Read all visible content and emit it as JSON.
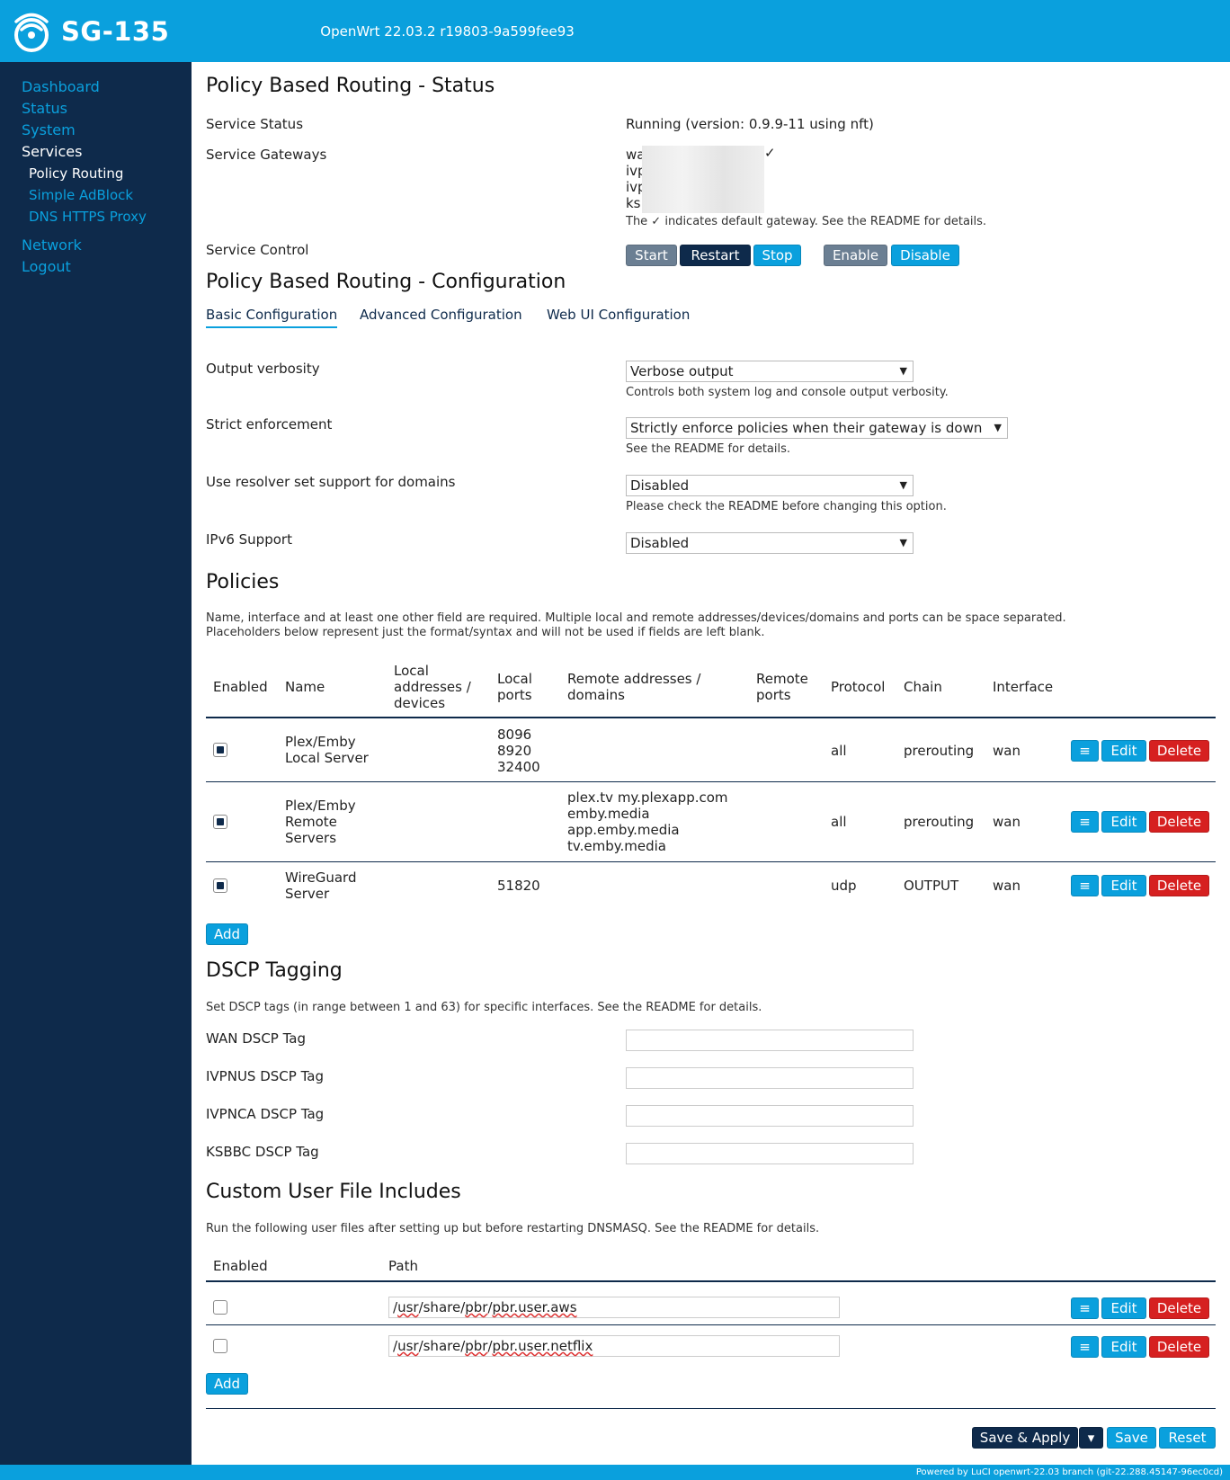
{
  "header": {
    "hostname": "SG-135",
    "firmware": "OpenWrt 22.03.2 r19803-9a599fee93"
  },
  "sidebar": {
    "items": [
      {
        "label": "Dashboard"
      },
      {
        "label": "Status"
      },
      {
        "label": "System"
      },
      {
        "label": "Services"
      },
      {
        "label": "Policy Routing"
      },
      {
        "label": "Simple AdBlock"
      },
      {
        "label": "DNS HTTPS Proxy"
      },
      {
        "label": "Network"
      },
      {
        "label": "Logout"
      }
    ]
  },
  "status": {
    "title": "Policy Based Routing - Status",
    "service_status_label": "Service Status",
    "service_status_value": "Running (version: 0.9.9-11 using nft)",
    "gateways_label": "Service Gateways",
    "gateways": [
      "wa",
      "ivp",
      "ivp",
      "ks"
    ],
    "gateway_check": "✓",
    "gateway_note": "The ✓ indicates default gateway. See the README for details.",
    "control_label": "Service Control",
    "buttons": {
      "start": "Start",
      "restart": "Restart",
      "stop": "Stop",
      "enable": "Enable",
      "disable": "Disable"
    }
  },
  "config": {
    "title": "Policy Based Routing - Configuration",
    "tabs": [
      "Basic Configuration",
      "Advanced Configuration",
      "Web UI Configuration"
    ],
    "output_verbosity": {
      "label": "Output verbosity",
      "value": "Verbose output",
      "hint": "Controls both system log and console output verbosity."
    },
    "strict_enforcement": {
      "label": "Strict enforcement",
      "value": "Strictly enforce policies when their gateway is down",
      "hint": "See the README for details."
    },
    "resolver_set": {
      "label": "Use resolver set support for domains",
      "value": "Disabled",
      "hint": "Please check the README before changing this option."
    },
    "ipv6": {
      "label": "IPv6 Support",
      "value": "Disabled"
    }
  },
  "policies": {
    "title": "Policies",
    "description_1": "Name, interface and at least one other field are required. Multiple local and remote addresses/devices/domains and ports can be space separated.",
    "description_2": "Placeholders below represent just the format/syntax and will not be used if fields are left blank.",
    "columns": {
      "enabled": "Enabled",
      "name": "Name",
      "local_addr_1": "Local",
      "local_addr_2": "addresses /",
      "local_addr_3": "devices",
      "local_ports_1": "Local",
      "local_ports_2": "ports",
      "remote_addr_1": "Remote addresses /",
      "remote_addr_2": "domains",
      "remote_ports_1": "Remote",
      "remote_ports_2": "ports",
      "protocol": "Protocol",
      "chain": "Chain",
      "interface": "Interface"
    },
    "rows": [
      {
        "name_1": "Plex/Emby",
        "name_2": "Local Server",
        "name_3": "",
        "local_ports_1": "8096",
        "local_ports_2": "8920",
        "local_ports_3": "32400",
        "remote_1": "",
        "remote_2": "",
        "remote_3": "",
        "remote_4": "",
        "protocol": "all",
        "chain": "prerouting",
        "interface": "wan"
      },
      {
        "name_1": "Plex/Emby",
        "name_2": "Remote",
        "name_3": "Servers",
        "local_ports_1": "",
        "local_ports_2": "",
        "local_ports_3": "",
        "remote_1": "plex.tv my.plexapp.com",
        "remote_2": "emby.media",
        "remote_3": "app.emby.media",
        "remote_4": "tv.emby.media",
        "protocol": "all",
        "chain": "prerouting",
        "interface": "wan"
      },
      {
        "name_1": "WireGuard",
        "name_2": "Server",
        "name_3": "",
        "local_ports_1": "51820",
        "local_ports_2": "",
        "local_ports_3": "",
        "remote_1": "",
        "remote_2": "",
        "remote_3": "",
        "remote_4": "",
        "protocol": "udp",
        "chain": "OUTPUT",
        "interface": "wan"
      }
    ],
    "row_buttons": {
      "drag": "≡",
      "edit": "Edit",
      "delete": "Delete"
    },
    "add": "Add"
  },
  "dscp": {
    "title": "DSCP Tagging",
    "description": "Set DSCP tags (in range between 1 and 63) for specific interfaces. See the README for details.",
    "fields": [
      "WAN DSCP Tag",
      "IVPNUS DSCP Tag",
      "IVPNCA DSCP Tag",
      "KSBBC DSCP Tag"
    ]
  },
  "includes": {
    "title": "Custom User File Includes",
    "description": "Run the following user files after setting up but before restarting DNSMASQ. See the README for details.",
    "col_enabled": "Enabled",
    "col_path": "Path",
    "rows": [
      {
        "p1": "/",
        "p2": "usr",
        "p3": "/share/",
        "p4": "pbr",
        "p5": "/",
        "p6": "pbr.user.aws"
      },
      {
        "p1": "/",
        "p2": "usr",
        "p3": "/share/",
        "p4": "pbr",
        "p5": "/",
        "p6": "pbr.user.netflix"
      }
    ],
    "add": "Add"
  },
  "actions": {
    "save_apply": "Save & Apply",
    "dropdown": "▾",
    "save": "Save",
    "reset": "Reset"
  },
  "footer": {
    "text": "Powered by LuCI openwrt-22.03 branch (git-22.288.45147-96ec0cd)"
  },
  "colors": {
    "brand": "#0aa0dd",
    "navy": "#0e2a4b",
    "danger": "#d62020",
    "neutral": "#6b7f93"
  }
}
